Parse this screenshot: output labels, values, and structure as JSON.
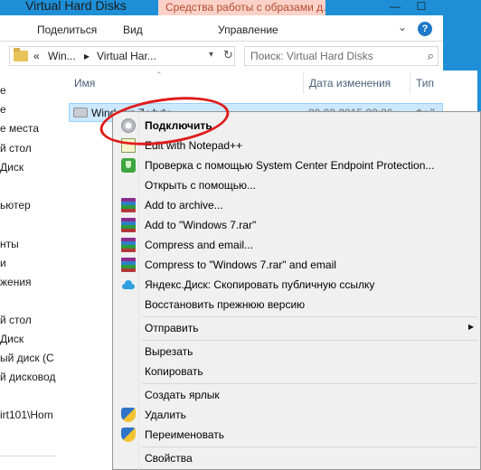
{
  "window": {
    "title": "Virtual Hard Disks",
    "tools_tab": "Средства работы с образами д...",
    "minimize": "—",
    "maximize": "☐"
  },
  "ribbon": {
    "tabs": [
      "Поделиться",
      "Вид",
      "Управление"
    ]
  },
  "address": {
    "crumbs": [
      "«",
      "Win...",
      "▸",
      "Virtual Har..."
    ],
    "search_placeholder": "Поиск: Virtual Hard Disks"
  },
  "nav": {
    "items": [
      "е",
      "е",
      "е места",
      "й стол",
      "Диск",
      "ьютер",
      "нты",
      "и",
      "жения",
      "й стол",
      "Диск",
      "ый диск (С",
      "й дисковод (",
      "irt101\\Hom"
    ]
  },
  "filelist": {
    "columns": [
      "Имя",
      "Дата изменения",
      "Тип"
    ],
    "rows": [
      {
        "name": "Windows 7.vhdx",
        "date": "30.03.2015 23:36",
        "type": "Фай"
      }
    ]
  },
  "context_menu": {
    "items": [
      {
        "label": "Подключить",
        "icon": "disk-icon",
        "bold": true
      },
      {
        "label": "Edit with Notepad++",
        "icon": "notepad-icon"
      },
      {
        "label": "Проверка с помощью System Center Endpoint Protection...",
        "icon": "scep-icon"
      },
      {
        "label": "Открыть с помощью...",
        "icon": ""
      },
      {
        "label": "Add to archive...",
        "icon": "winrar-icon"
      },
      {
        "label": "Add to \"Windows 7.rar\"",
        "icon": "winrar-icon"
      },
      {
        "label": "Compress and email...",
        "icon": "winrar-icon"
      },
      {
        "label": "Compress to \"Windows 7.rar\" and email",
        "icon": "winrar-icon"
      },
      {
        "label": "Яндекс.Диск: Скопировать публичную ссылку",
        "icon": "yandex-disk-icon"
      },
      {
        "label": "Восстановить прежнюю версию",
        "icon": ""
      },
      {
        "label": "Отправить",
        "icon": "",
        "submenu": true
      },
      {
        "label": "Вырезать",
        "icon": ""
      },
      {
        "label": "Копировать",
        "icon": ""
      },
      {
        "label": "Создать ярлык",
        "icon": ""
      },
      {
        "label": "Удалить",
        "icon": "uac-shield-icon"
      },
      {
        "label": "Переименовать",
        "icon": "uac-shield-icon"
      },
      {
        "label": "Свойства",
        "icon": ""
      }
    ]
  },
  "colors": {
    "title_bar": "#1e8fd6",
    "tools_tab_bg": "#fcd2c8",
    "selection": "#cce8ff",
    "menu_bg": "#f0f0f0",
    "highlight_ring": "#e01b1b"
  }
}
